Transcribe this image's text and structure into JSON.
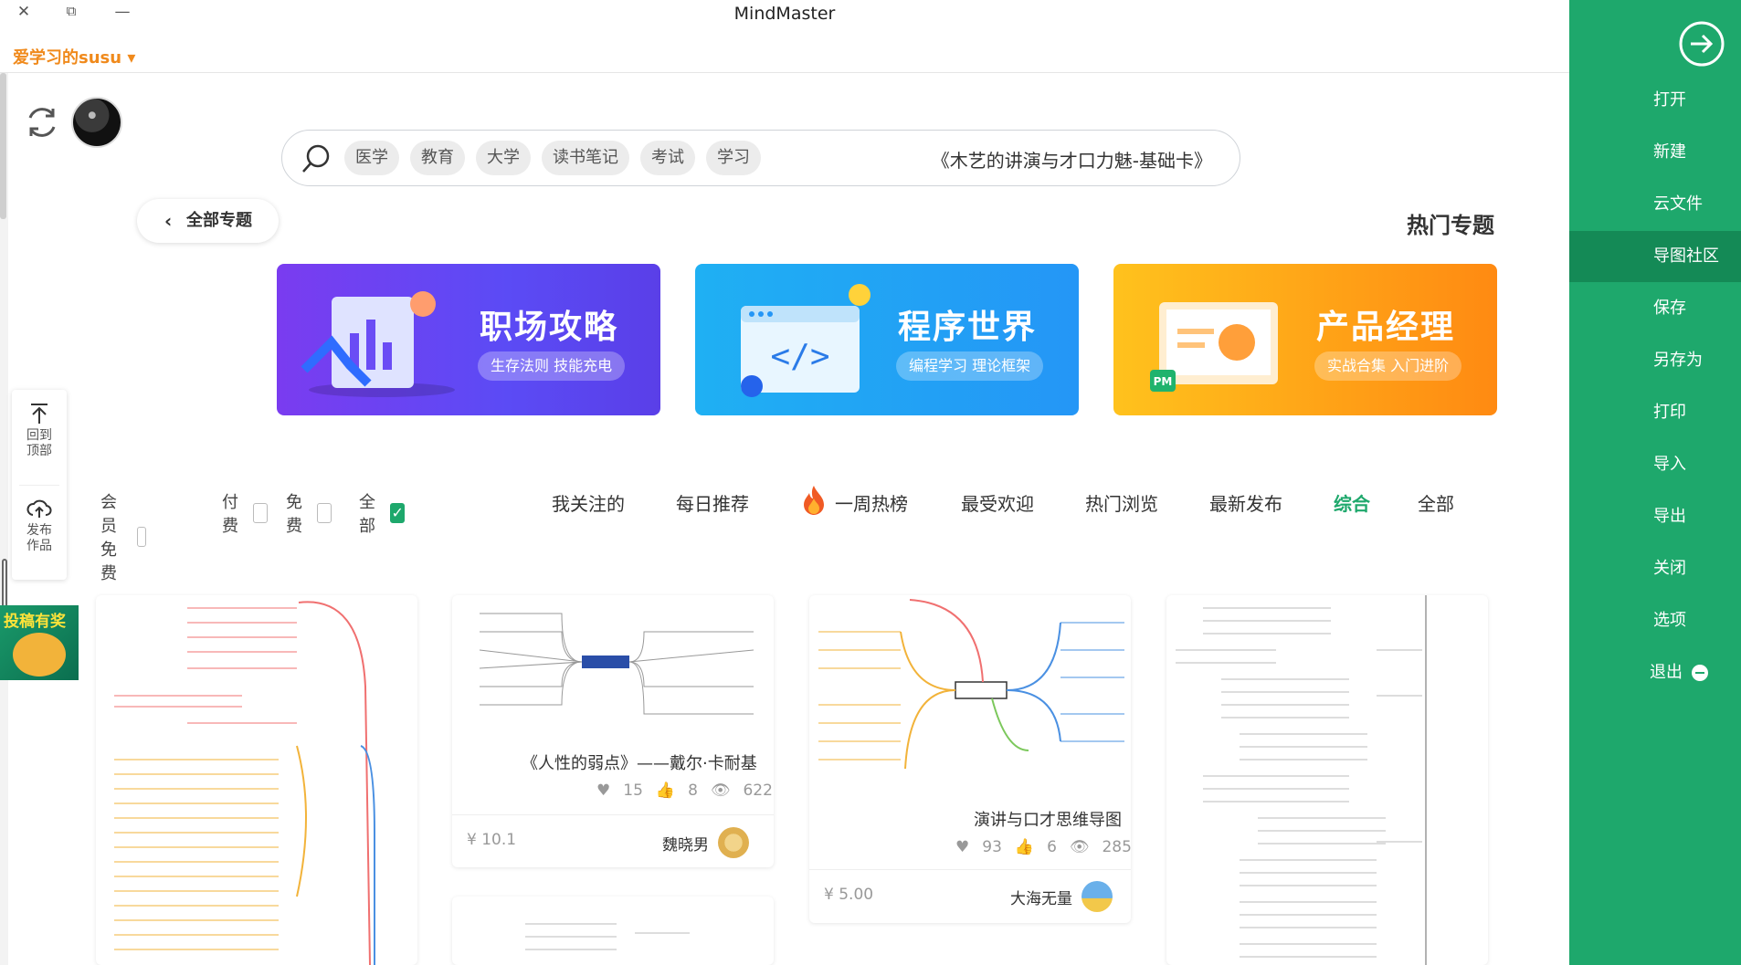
{
  "window": {
    "title": "MindMaster",
    "close": "✕",
    "restore": "⧉",
    "minimize": "—"
  },
  "user": {
    "name": "爱学习的susu ▾"
  },
  "search": {
    "placeholder": "《木艺的讲演与才口力魅-基础卡》",
    "tags": [
      "学习",
      "考试",
      "读书笔记",
      "大学",
      "教育",
      "医学"
    ]
  },
  "section": {
    "title": "热门专题",
    "all_topics": "全部专题"
  },
  "banners": [
    {
      "title": "职场攻略",
      "subtitle": "生存法则 技能充电",
      "color": "#7a3cf0"
    },
    {
      "title": "程序世界",
      "subtitle": "编程学习 理论框架",
      "color": "#1fb0f3"
    },
    {
      "title": "产品经理",
      "subtitle": "实战合集 入门进阶",
      "color": "#ffa018"
    }
  ],
  "floatpanel": {
    "top": "回到\n顶部",
    "publish": "发布\n作品"
  },
  "lottery": {
    "label": "投稿有奖"
  },
  "filters": [
    {
      "label": "全部",
      "checked": true
    },
    {
      "label": "免费",
      "checked": false
    },
    {
      "label": "付费",
      "checked": false
    },
    {
      "label": "会员免费",
      "checked": false
    }
  ],
  "tabs": [
    "我关注的",
    "每日推荐",
    "一周热榜",
    "最受欢迎",
    "热门浏览",
    "最新发布",
    "综合",
    "全部"
  ],
  "active_tab": "综合",
  "cards": [
    {
      "title": "《人性的弱点》——戴尔·卡耐基",
      "views": "622",
      "likes": "8",
      "favorites": "15",
      "author": "魏晓男",
      "price": "¥ 10.1"
    },
    {
      "title": "演讲与口才思维导图",
      "views": "285",
      "likes": "6",
      "favorites": "93",
      "author": "大海无量",
      "price": "¥ 5.00"
    }
  ],
  "sidebar": {
    "items": [
      "打开",
      "新建",
      "云文件",
      "导图社区",
      "保存",
      "另存为",
      "打印",
      "导入",
      "导出",
      "关闭",
      "选项",
      "退出"
    ],
    "active": "导图社区"
  }
}
